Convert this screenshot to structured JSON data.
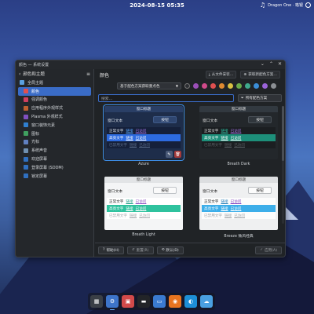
{
  "topbar": {
    "clock": "2024-08-15 05:35",
    "user": "Dragon One · 珞银"
  },
  "window": {
    "title": "颜色 — 系统设置",
    "min": "⌄",
    "max": "⌃",
    "close": "✕"
  },
  "sidebar": {
    "header": "颜色和主题",
    "items": [
      {
        "label": "全局主题",
        "sub": false,
        "color": "#5aa0e0"
      },
      {
        "label": "颜色",
        "sub": true,
        "sel": true,
        "color": "#e05050"
      },
      {
        "label": "强调颜色",
        "sub": true,
        "color": "#d04060"
      },
      {
        "label": "应用程序外观样式",
        "sub": true,
        "color": "#c06030"
      },
      {
        "label": "Plasma 外观样式",
        "sub": true,
        "color": "#8050c0"
      },
      {
        "label": "窗口装饰元素",
        "sub": true,
        "color": "#3080d0"
      },
      {
        "label": "图标",
        "sub": true,
        "color": "#40a060"
      },
      {
        "label": "光标",
        "sub": true,
        "color": "#6080c0"
      },
      {
        "label": "系统声音",
        "sub": true,
        "color": "#7090b0"
      },
      {
        "label": "欢迎屏幕",
        "sub": true,
        "color": "#3070c0"
      },
      {
        "label": "登录屏幕 (SDDM)",
        "sub": true,
        "color": "#3070c0"
      },
      {
        "label": "锁定屏幕",
        "sub": true,
        "color": "#3070c0"
      }
    ]
  },
  "main": {
    "title": "颜色",
    "btn_import": "从文件安装…",
    "btn_get": "获取新配色方案…",
    "dropdown": "基于配色方案获取重点色",
    "swatches": [
      "#2b2e32",
      "#9b4fb8",
      "#d04a8a",
      "#e05050",
      "#e08a30",
      "#d9c042",
      "#6aab4a",
      "#3fa98c",
      "#3b8ed8",
      "#9a63d8",
      "#8b8f94"
    ],
    "search_placeholder": "搜索…",
    "filter": "所有配色方案"
  },
  "preview_common": {
    "window_title": "窗口标题",
    "window_text": "窗口文本",
    "button": "按钮",
    "normal": "正常文字",
    "link": "链接",
    "visited": "已访问",
    "highlight": "高亮文字",
    "disabled": "已禁用文字"
  },
  "cards": [
    {
      "name": "Azure"
    },
    {
      "name": "Breath Dark"
    },
    {
      "name": "Breath Light"
    },
    {
      "name": "Breeze 微风经典"
    }
  ],
  "footer": {
    "help": "帮助(H)",
    "reset": "重置(R)",
    "defaults": "默认(D)",
    "apply": "应用(A)"
  },
  "dock": [
    {
      "name": "desktop-switcher",
      "color": "#3a3f46"
    },
    {
      "name": "settings",
      "color": "#3d74c9"
    },
    {
      "name": "store",
      "color": "#d24a4a"
    },
    {
      "name": "files",
      "color": "#222428"
    },
    {
      "name": "folder",
      "color": "#3a7ad0"
    },
    {
      "name": "firefox",
      "color": "#e8741f"
    },
    {
      "name": "edge",
      "color": "#1d8fd6"
    },
    {
      "name": "weather",
      "color": "#4aa0e0"
    }
  ]
}
